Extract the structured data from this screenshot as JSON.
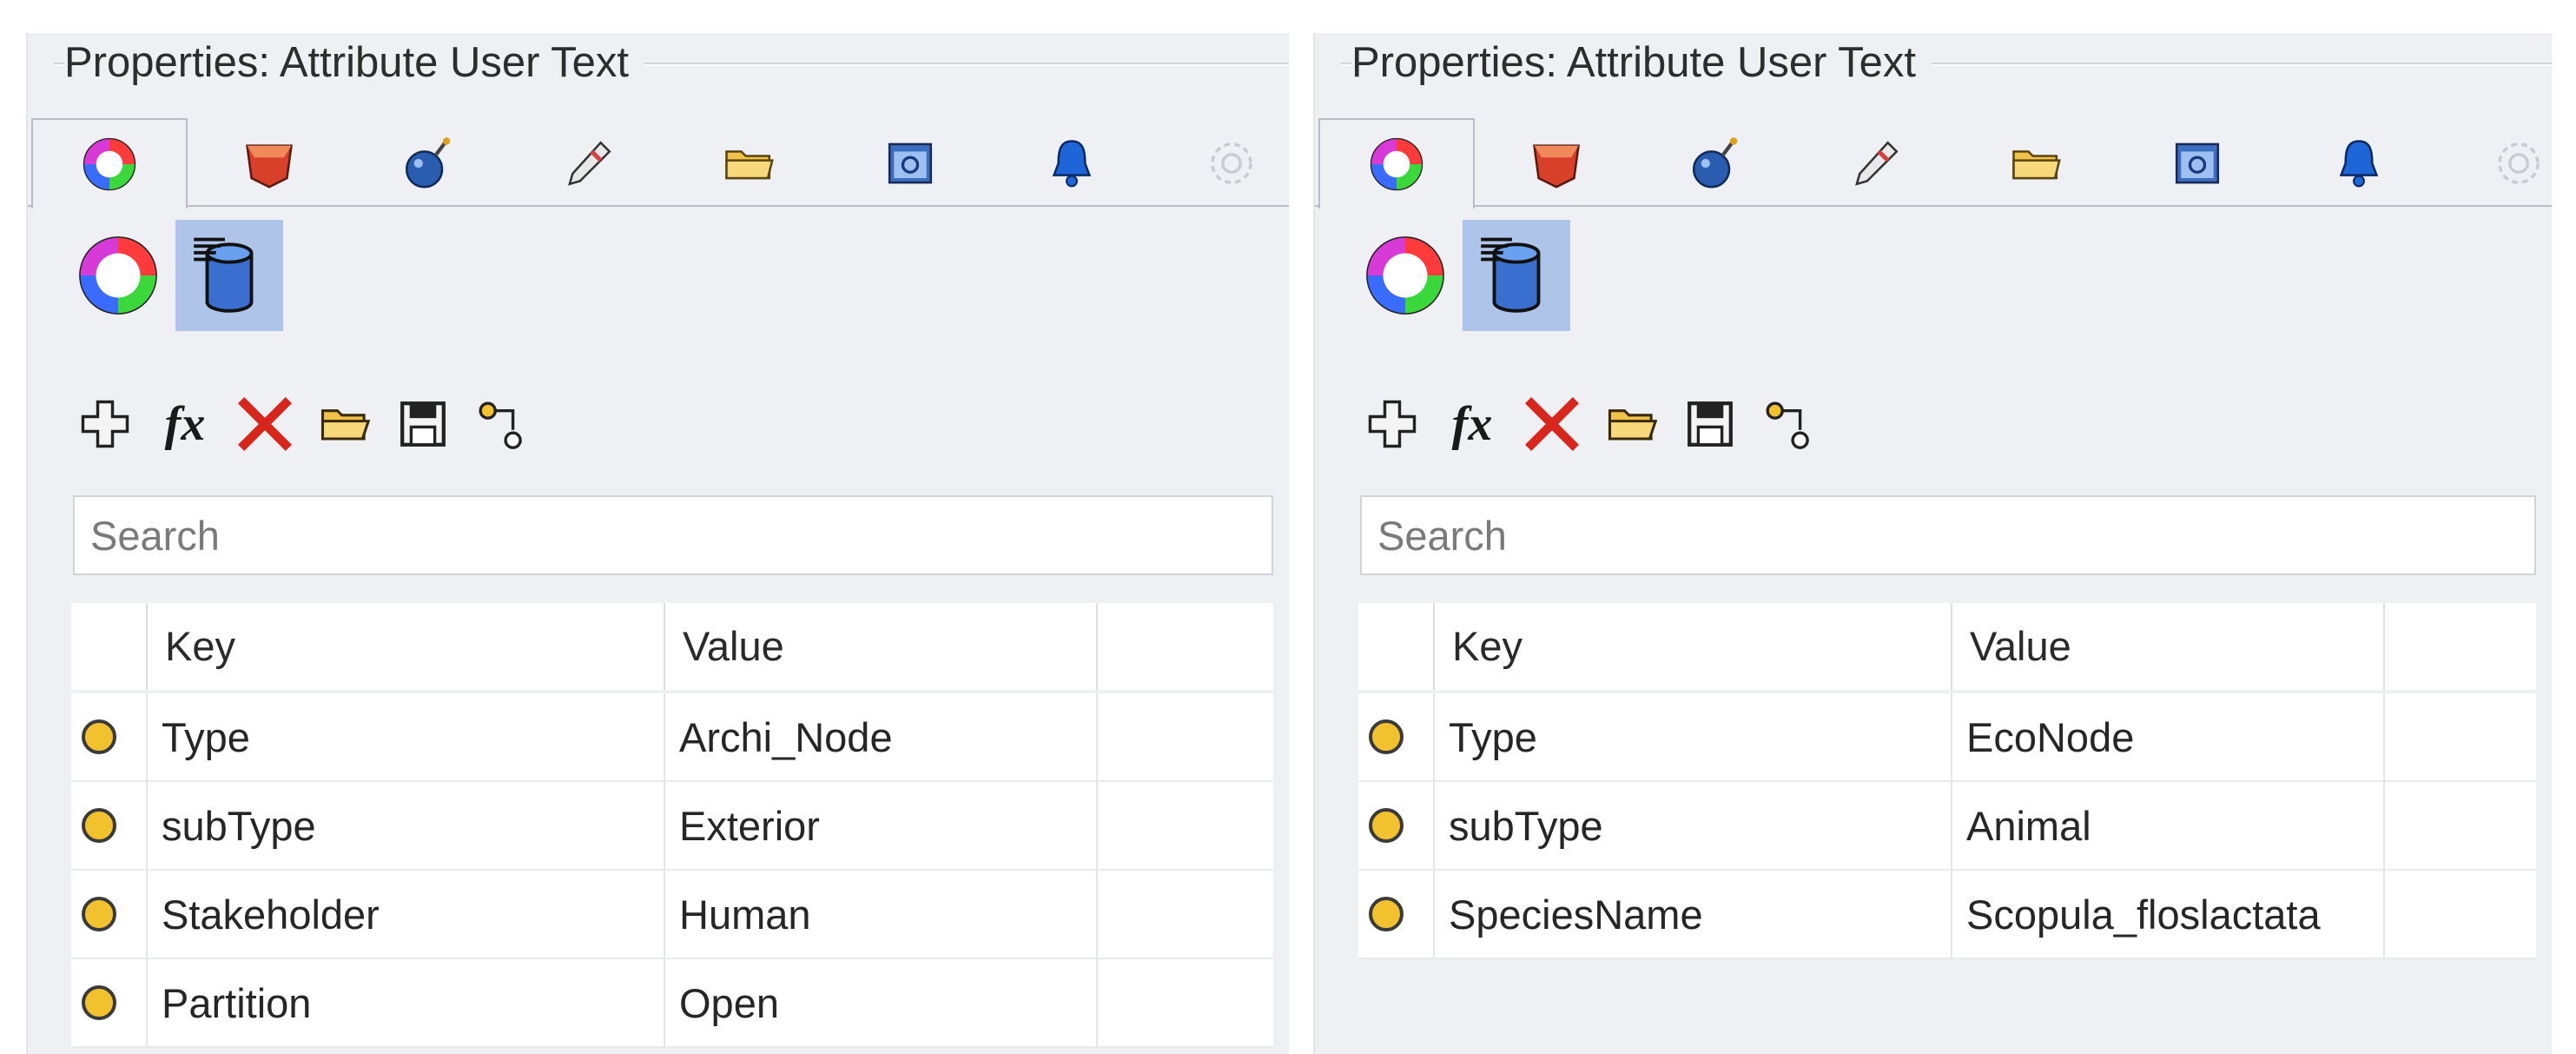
{
  "panels": [
    {
      "title": "Properties: Attribute User Text",
      "tabs": [
        "color-wheel-icon",
        "material-icon",
        "bomb-icon",
        "pencil-icon",
        "folder-icon",
        "window-icon",
        "bell-icon",
        "gear-icon"
      ],
      "search_placeholder": "Search",
      "columns": {
        "key": "Key",
        "value": "Value"
      },
      "rows": [
        {
          "key": "Type",
          "value": "Archi_Node"
        },
        {
          "key": "subType",
          "value": "Exterior"
        },
        {
          "key": "Stakeholder",
          "value": "Human"
        },
        {
          "key": "Partition",
          "value": "Open"
        }
      ]
    },
    {
      "title": "Properties: Attribute User Text",
      "tabs": [
        "color-wheel-icon",
        "material-icon",
        "bomb-icon",
        "pencil-icon",
        "folder-icon",
        "window-icon",
        "bell-icon",
        "gear-icon"
      ],
      "search_placeholder": "Search",
      "columns": {
        "key": "Key",
        "value": "Value"
      },
      "rows": [
        {
          "key": "Type",
          "value": "EcoNode"
        },
        {
          "key": "subType",
          "value": "Animal"
        },
        {
          "key": "SpeciesName",
          "value": "Scopula_floslactata"
        }
      ]
    }
  ],
  "toolbar_icons": [
    "add-icon",
    "function-icon",
    "delete-icon",
    "open-folder-icon",
    "save-icon",
    "link-icon"
  ],
  "toolbar_fx_text": "fx",
  "subbar_icons": [
    "color-wheel-icon",
    "database-icon"
  ],
  "colors": {
    "panel_bg": "#eef0f3",
    "selection": "#aec4e8",
    "row_dot": "#f2c12e",
    "delete_red": "#d9261c"
  }
}
